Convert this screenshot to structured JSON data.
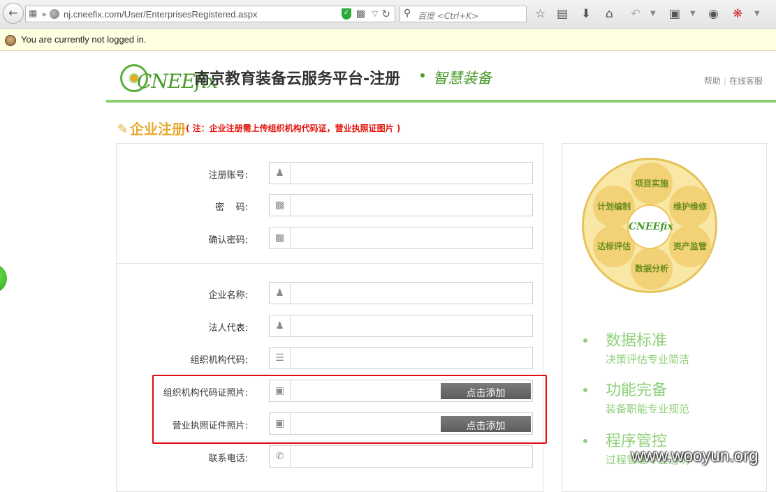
{
  "browser": {
    "url": "nj.cneefix.com/User/EnterprisesRegistered.aspx",
    "search_placeholder": "百度 <Ctrl+K>"
  },
  "notification": {
    "text": "You are currently not logged in."
  },
  "header": {
    "logo_text": "CNEEfix",
    "title": "南京教育装备云服务平台-注册",
    "slogan": "智慧装备",
    "links": [
      "帮助",
      "在线客服"
    ]
  },
  "section": {
    "title": "企业注册",
    "note": "( 注：企业注册需上传组织机构代码证，营业执照证图片 )"
  },
  "form": {
    "account": {
      "label": "注册账号:",
      "icon": "user-icon"
    },
    "password": {
      "label": "密    码:",
      "icon": "lock-icon"
    },
    "confirm": {
      "label": "确认密码:",
      "icon": "lock-icon"
    },
    "company": {
      "label": "企业名称:",
      "icon": "user-icon"
    },
    "legal": {
      "label": "法人代表:",
      "icon": "user-icon"
    },
    "orgcode": {
      "label": "组织机构代码:",
      "icon": "card-icon"
    },
    "orgphoto": {
      "label": "组织机构代码证照片:",
      "icon": "image-icon",
      "button": "点击添加"
    },
    "bizphoto": {
      "label": "营业执照证件照片:",
      "icon": "image-icon",
      "button": "点击添加"
    },
    "phone": {
      "label": "联系电话:",
      "icon": "phone-icon"
    }
  },
  "diagram": {
    "petals": [
      "项目实施",
      "维护维修",
      "资产监管",
      "数据分析",
      "达标评估",
      "计划编制"
    ],
    "center": "CNEEfix"
  },
  "features": [
    {
      "title": "数据标准",
      "sub": "决策评估专业简洁"
    },
    {
      "title": "功能完备",
      "sub": "装备职能专业规范"
    },
    {
      "title": "程序管控",
      "sub": "过程管理专业透明"
    }
  ],
  "watermark": "www.wooyun.org",
  "colors": {
    "green": "#4a9b2c",
    "light_green": "#8fd07a",
    "orange": "#e6a82c",
    "highlight_red": "#e10c0c"
  }
}
